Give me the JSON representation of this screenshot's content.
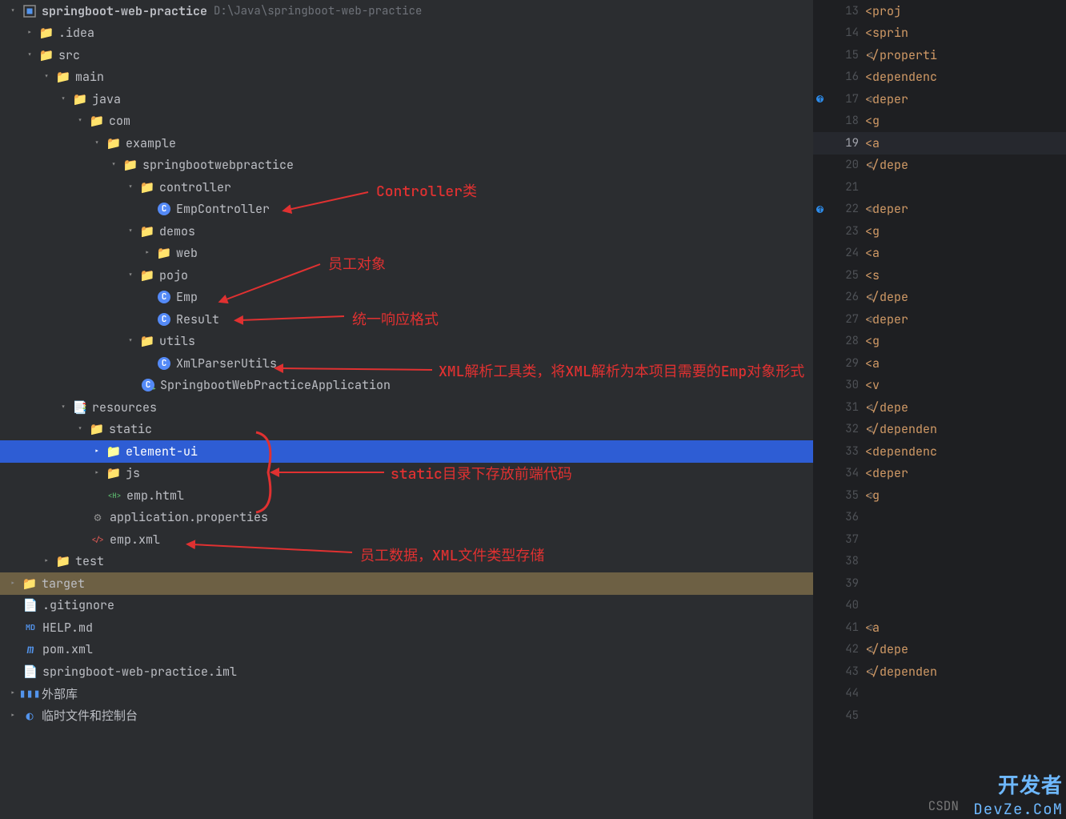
{
  "project": {
    "name": "springboot-web-practice",
    "path": "D:\\Java\\springboot-web-practice"
  },
  "tree": {
    "idea": ".idea",
    "src": "src",
    "main": "main",
    "java": "java",
    "com": "com",
    "example": "example",
    "pkg": "springbootwebpractice",
    "controller": "controller",
    "EmpController": "EmpController",
    "demos": "demos",
    "web": "web",
    "pojo": "pojo",
    "Emp": "Emp",
    "Result": "Result",
    "utils": "utils",
    "XmlParserUtils": "XmlParserUtils",
    "Application": "SpringbootWebPracticeApplication",
    "resources": "resources",
    "static": "static",
    "elementui": "element-ui",
    "js": "js",
    "emphtml": "emp.html",
    "appprops": "application.properties",
    "empxml": "emp.xml",
    "test": "test",
    "target": "target",
    "gitignore": ".gitignore",
    "helpmd": "HELP.md",
    "pom": "pom.xml",
    "iml": "springboot-web-practice.iml",
    "extlib": "外部库",
    "scratch": "临时文件和控制台"
  },
  "annotations": {
    "controller": "Controller类",
    "empObj": "员工对象",
    "result": "统一响应格式",
    "xmlutils": "XML解析工具类，将XML解析为本项目需要的Emp对象形式",
    "static": "static目录下存放前端代码",
    "empxml": "员工数据，XML文件类型存储"
  },
  "gutter": {
    "start": 13,
    "end": 45,
    "active": 19,
    "upMarks": [
      17,
      22
    ],
    "folds": [
      15,
      17,
      20,
      22,
      26,
      27,
      31,
      32,
      35,
      41,
      42,
      43
    ]
  },
  "code": [
    {
      "indent": 16,
      "text": "<proj"
    },
    {
      "indent": 16,
      "text": "<sprin"
    },
    {
      "indent": 12,
      "text": "</properti"
    },
    {
      "indent": 12,
      "text": "<dependenc"
    },
    {
      "indent": 16,
      "text": "<deper"
    },
    {
      "indent": 20,
      "text": "<g"
    },
    {
      "indent": 20,
      "text": "<a",
      "active": true
    },
    {
      "indent": 16,
      "text": "</depe"
    },
    {
      "indent": 0,
      "text": ""
    },
    {
      "indent": 16,
      "text": "<deper"
    },
    {
      "indent": 20,
      "text": "<g"
    },
    {
      "indent": 20,
      "text": "<a"
    },
    {
      "indent": 20,
      "text": "<s"
    },
    {
      "indent": 16,
      "text": "</depe"
    },
    {
      "indent": 16,
      "text": "<deper"
    },
    {
      "indent": 20,
      "text": "<g"
    },
    {
      "indent": 20,
      "text": "<a"
    },
    {
      "indent": 20,
      "text": "<v"
    },
    {
      "indent": 16,
      "text": "</depe"
    },
    {
      "indent": 12,
      "text": "</dependen"
    },
    {
      "indent": 12,
      "text": "<dependenc"
    },
    {
      "indent": 16,
      "text": "<deper"
    },
    {
      "indent": 20,
      "text": "<g"
    },
    {
      "indent": 0,
      "text": ""
    },
    {
      "indent": 0,
      "text": ""
    },
    {
      "indent": 0,
      "text": ""
    },
    {
      "indent": 0,
      "text": ""
    },
    {
      "indent": 0,
      "text": ""
    },
    {
      "indent": 20,
      "text": "<a"
    },
    {
      "indent": 16,
      "text": "</depe"
    },
    {
      "indent": 12,
      "text": "</dependen"
    },
    {
      "indent": 0,
      "text": ""
    },
    {
      "indent": 0,
      "text": ""
    }
  ],
  "watermark": {
    "big": "开发者",
    "small": "DevZe.CoM",
    "csdn": "CSDN"
  }
}
